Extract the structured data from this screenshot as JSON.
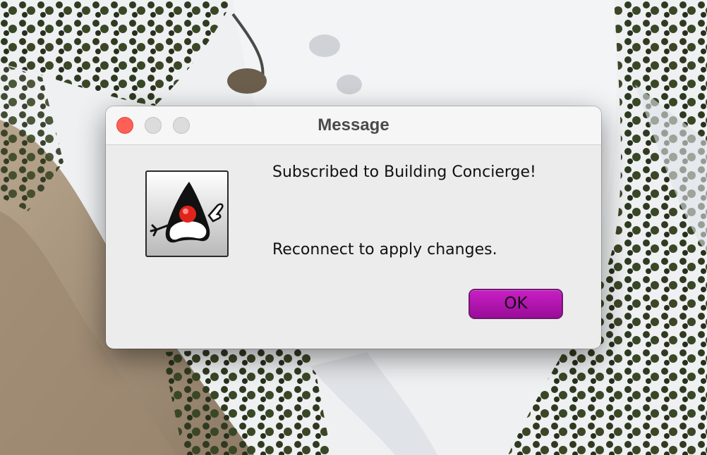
{
  "window": {
    "title": "Message",
    "buttons": [
      "close",
      "minimize",
      "zoom"
    ]
  },
  "dialog": {
    "icon": "java-duke-icon",
    "message_line1": "Subscribed to Building Concierge!",
    "message_line2": "Reconnect to apply changes.",
    "ok_label": "OK"
  },
  "colors": {
    "ok_button": "#b014ae",
    "close_button": "#fe5f57",
    "dialog_background": "#ececec"
  },
  "desktop": {
    "wallpaper": "aerial-snowy-forest"
  }
}
